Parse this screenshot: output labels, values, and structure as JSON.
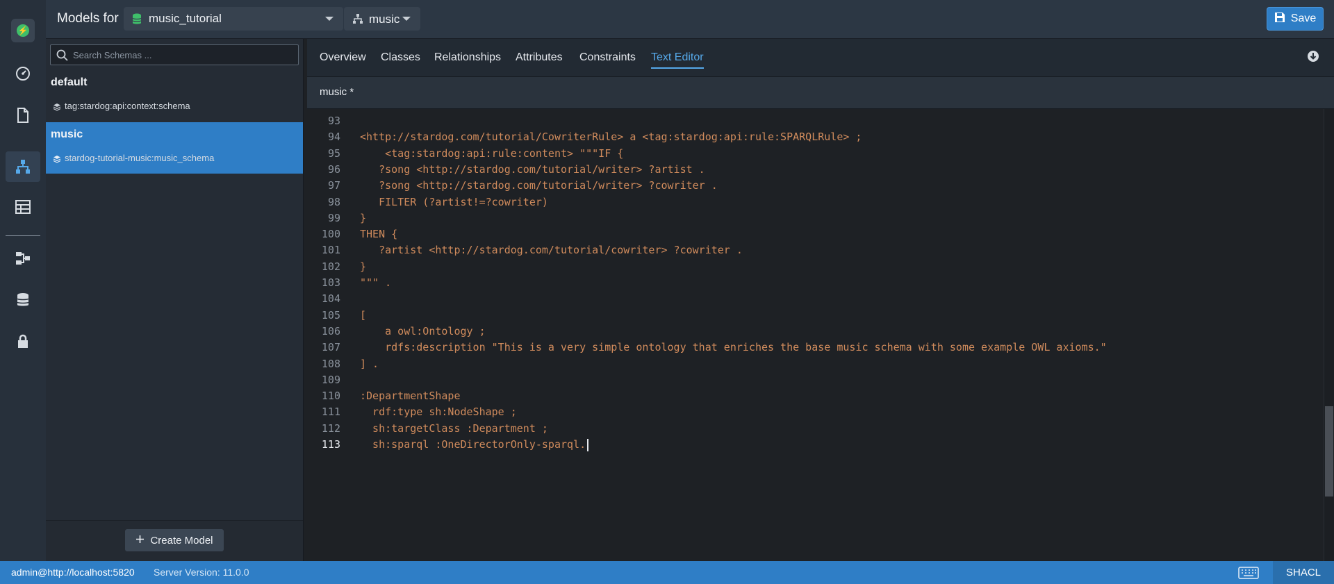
{
  "header": {
    "title": "Models for",
    "database": "music_tutorial",
    "schema": "music",
    "save_label": "Save"
  },
  "sidebar": {
    "search_placeholder": "Search Schemas ...",
    "groups": [
      {
        "name": "default",
        "item": "tag:stardog:api:context:schema",
        "selected": false
      },
      {
        "name": "music",
        "item": "stardog-tutorial-music:music_schema",
        "selected": true
      }
    ],
    "create_label": "Create Model"
  },
  "tabs": [
    "Overview",
    "Classes",
    "Relationships",
    "Attributes",
    "Constraints",
    "Text Editor"
  ],
  "active_tab": "Text Editor",
  "document": {
    "title": "music *"
  },
  "editor": {
    "current_line": 113,
    "lines": [
      {
        "n": "93",
        "text": ""
      },
      {
        "n": "94",
        "text": "<http://stardog.com/tutorial/CowriterRule> a <tag:stardog:api:rule:SPARQLRule> ;"
      },
      {
        "n": "95",
        "text": "    <tag:stardog:api:rule:content> \"\"\"IF {"
      },
      {
        "n": "96",
        "text": "   ?song <http://stardog.com/tutorial/writer> ?artist ."
      },
      {
        "n": "97",
        "text": "   ?song <http://stardog.com/tutorial/writer> ?cowriter ."
      },
      {
        "n": "98",
        "text": "   FILTER (?artist!=?cowriter)"
      },
      {
        "n": "99",
        "text": "}"
      },
      {
        "n": "100",
        "text": "THEN {"
      },
      {
        "n": "101",
        "text": "   ?artist <http://stardog.com/tutorial/cowriter> ?cowriter ."
      },
      {
        "n": "102",
        "text": "}"
      },
      {
        "n": "103",
        "text": "\"\"\" ."
      },
      {
        "n": "104",
        "text": ""
      },
      {
        "n": "105",
        "text": "["
      },
      {
        "n": "106",
        "text": "    a owl:Ontology ;"
      },
      {
        "n": "107",
        "text": "    rdfs:description \"This is a very simple ontology that enriches the base music schema with some example OWL axioms.\""
      },
      {
        "n": "108",
        "text": "] ."
      },
      {
        "n": "109",
        "text": ""
      },
      {
        "n": "110",
        "text": ":DepartmentShape"
      },
      {
        "n": "111",
        "text": "  rdf:type sh:NodeShape ;"
      },
      {
        "n": "112",
        "text": "  sh:targetClass :Department ;"
      },
      {
        "n": "113",
        "text": "  sh:sparql :OneDirectorOnly-sparql."
      }
    ]
  },
  "status": {
    "user": "admin@http://localhost:5820",
    "version": "Server Version: 11.0.0",
    "mode": "SHACL"
  },
  "colors": {
    "accent": "#2f7ec6",
    "active_tab": "#56a9ea",
    "code": "#d08b5c"
  },
  "rail_icons": [
    "stardog-logo-icon",
    "dashboard-icon",
    "document-icon",
    "models-icon",
    "table-icon",
    "mapping-icon",
    "database-icon",
    "lock-icon"
  ]
}
